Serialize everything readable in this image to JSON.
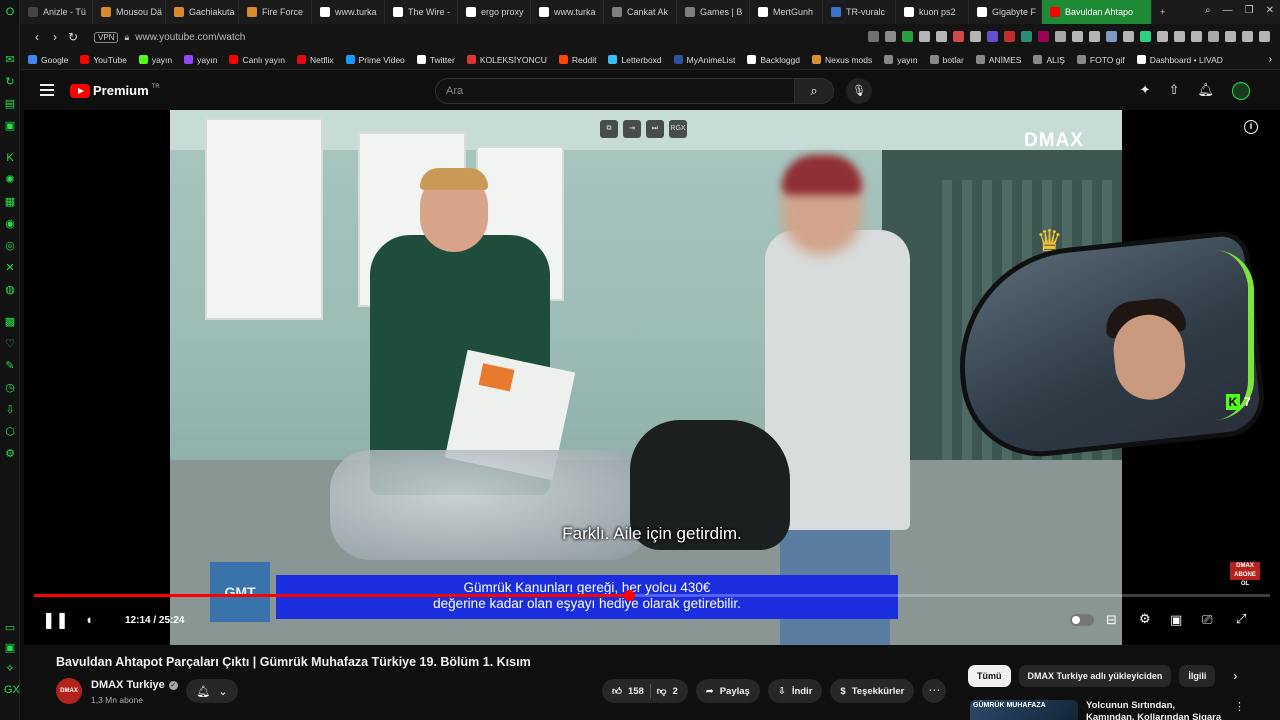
{
  "browser": {
    "tabs": [
      {
        "label": "Anizle - Tü",
        "color": "#444444"
      },
      {
        "label": "Mousou Dä",
        "color": "#d98b2b"
      },
      {
        "label": "Gachiakuta",
        "color": "#d98b2b"
      },
      {
        "label": "Fire Force",
        "color": "#d98b2b"
      },
      {
        "label": "www.turka",
        "color": "#ffffff"
      },
      {
        "label": "The Wire -",
        "color": "#ffffff"
      },
      {
        "label": "ergo proxy",
        "color": "#ffffff"
      },
      {
        "label": "www.turka",
        "color": "#ffffff"
      },
      {
        "label": "Cankat Ak",
        "color": "#7e7e7e"
      },
      {
        "label": "Games | B",
        "color": "#7e7e7e"
      },
      {
        "label": "MertGunh",
        "color": "#ffffff"
      },
      {
        "label": "TR-vuralc",
        "color": "#3a73c9"
      },
      {
        "label": "kuon ps2",
        "color": "#ffffff"
      },
      {
        "label": "Gigabyte F",
        "color": "#ffffff"
      },
      {
        "label": "Bavuldan Ahtapo",
        "color": "#ff0000",
        "active": true
      }
    ],
    "new_tab": "+",
    "vpn_label": "VPN",
    "url": "www.youtube.com/watch",
    "bookmarks": [
      {
        "label": "Google",
        "color": "#4285f4"
      },
      {
        "label": "YouTube",
        "color": "#ff0000"
      },
      {
        "label": "yayın",
        "color": "#53fc18"
      },
      {
        "label": "yayın",
        "color": "#9146ff"
      },
      {
        "label": "Canlı yayın",
        "color": "#ff0000"
      },
      {
        "label": "Netflix",
        "color": "#e50914"
      },
      {
        "label": "Prime Video",
        "color": "#1a98ff"
      },
      {
        "label": "Twitter",
        "color": "#ffffff"
      },
      {
        "label": "KOLEKSİYONCU",
        "color": "#d33"
      },
      {
        "label": "Reddit",
        "color": "#ff4500"
      },
      {
        "label": "Letterboxd",
        "color": "#40bcf4"
      },
      {
        "label": "MyAnimeList",
        "color": "#2e51a2"
      },
      {
        "label": "Backloggd",
        "color": "#ffffff"
      },
      {
        "label": "Nexus mods",
        "color": "#da8e35"
      },
      {
        "label": "yayın",
        "color": "#888888"
      },
      {
        "label": "botlar",
        "color": "#888888"
      },
      {
        "label": "ANİMES",
        "color": "#888888"
      },
      {
        "label": "ALIŞ",
        "color": "#888888"
      },
      {
        "label": "FOTO gif",
        "color": "#888888"
      },
      {
        "label": "Dashboard • LIVAD",
        "color": "#ffffff"
      }
    ]
  },
  "youtube": {
    "logo_text": "Premium",
    "logo_region": "TR",
    "search_placeholder": "Ara",
    "player": {
      "channel_watermark": "DMAX",
      "subtitle": "Farklı. Aile için getirdim.",
      "lower_third_line1": "Gümrük Kanunları gereği, her yolcu 430€",
      "lower_third_line2": "değerine kadar olan eşyayı hediye olarak getirebilir.",
      "show_logo": "GMT",
      "corner_logo": "DMAX ABONE OL",
      "overlay_ctrls": [
        "⧉",
        "⇥",
        "⏭",
        "RGX"
      ],
      "time_current": "12:14",
      "time_total": "25:24",
      "time_sep": " / ",
      "progress": 0.481,
      "streamer_kick_count": "7"
    },
    "video": {
      "title": "Bavuldan Ahtapot Parçaları Çıktı | Gümrük Muhafaza Türkiye 19. Bölüm 1. Kısım",
      "channel": "DMAX Turkiye",
      "channel_avatar": "DMAX",
      "subscribers": "1,3 Mn abone",
      "likes": "158",
      "dislikes": "2",
      "share": "Paylaş",
      "download": "İndir",
      "thanks": "Teşekkürler"
    },
    "chips": [
      "Tümü",
      "DMAX Turkiye adlı yükleyiciden",
      "İlgili"
    ],
    "recommendation": {
      "thumb_text": "GÜMRÜK MUHAFAZA",
      "title": "Yolcunun Sırtından, Kamından, Kollarından Sigara Çıktı |"
    }
  }
}
